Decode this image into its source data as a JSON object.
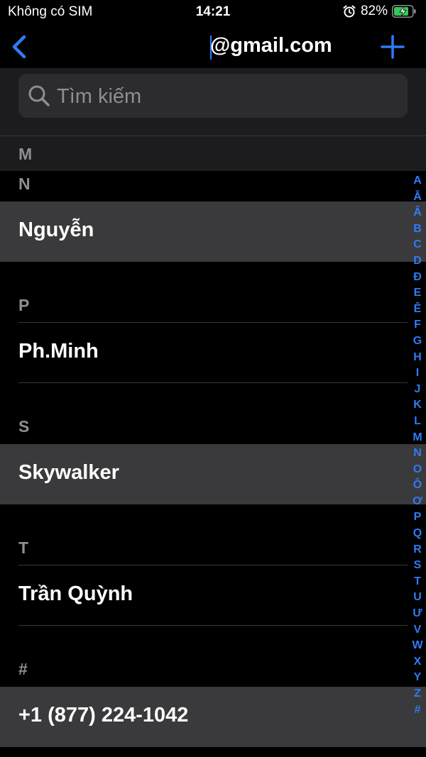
{
  "status_bar": {
    "carrier": "Không có SIM",
    "time": "14:21",
    "battery_percent": "82%",
    "icons": [
      "alarm-icon",
      "battery-charging-icon"
    ]
  },
  "nav": {
    "title": "@gmail.com",
    "back_icon": "chevron-left-icon",
    "add_icon": "plus-icon",
    "accent_color": "#2f7bf5"
  },
  "search": {
    "placeholder": "Tìm kiếm",
    "value": ""
  },
  "sections": {
    "m": "M",
    "n": "N",
    "p": "P",
    "s": "S",
    "t": "T",
    "hash": "#"
  },
  "contacts": [
    {
      "name": "Nguyễn",
      "highlighted": true
    },
    {
      "name": "Ph.Minh",
      "highlighted": false
    },
    {
      "name": "Skywalker",
      "highlighted": true
    },
    {
      "name": "Trần Quỳnh",
      "highlighted": false
    },
    {
      "name": "+1 (877) 224-1042",
      "highlighted": true
    }
  ],
  "index_letters": [
    "A",
    "Ă",
    "Â",
    "B",
    "C",
    "D",
    "Đ",
    "E",
    "Ê",
    "F",
    "G",
    "H",
    "I",
    "J",
    "K",
    "L",
    "M",
    "N",
    "O",
    "Ô",
    "Ơ",
    "P",
    "Q",
    "R",
    "S",
    "T",
    "U",
    "Ư",
    "V",
    "W",
    "X",
    "Y",
    "Z",
    "#"
  ]
}
